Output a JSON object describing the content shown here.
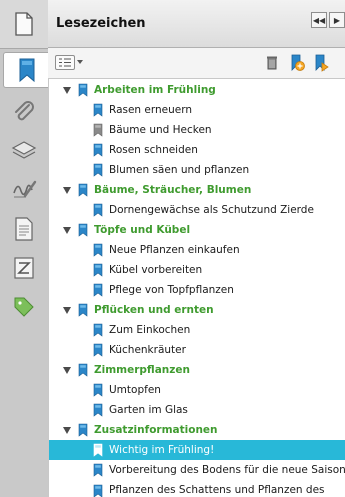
{
  "panel": {
    "title": "Lesezeichen",
    "header_buttons": [
      "◀◀",
      "▶"
    ]
  },
  "sidebar_icons": [
    "pages-icon",
    "bookmark-icon",
    "attachment-icon",
    "layers-icon",
    "signature-icon",
    "article-icon",
    "content-icon",
    "tag-icon"
  ],
  "colors": {
    "top_level_text": "#3f9b2f",
    "selected_row": "#28b8d8",
    "bookmark_blue": "#2b86c8",
    "bookmark_gray": "#8a8a8a"
  },
  "tree": [
    {
      "label": "Arbeiten im Frühling",
      "level": 0,
      "expanded": true,
      "icon": "blue"
    },
    {
      "label": "Rasen erneuern",
      "level": 1,
      "icon": "blue"
    },
    {
      "label": "Bäume und Hecken",
      "level": 1,
      "icon": "gray"
    },
    {
      "label": "Rosen schneiden",
      "level": 1,
      "icon": "blue"
    },
    {
      "label": "Blumen säen und pflanzen",
      "level": 1,
      "icon": "blue"
    },
    {
      "label": "Bäume, Sträucher, Blumen",
      "level": 0,
      "expanded": true,
      "icon": "blue"
    },
    {
      "label": "Dornengewächse als Schutzund Zierde",
      "level": 1,
      "icon": "blue"
    },
    {
      "label": "Töpfe und Kübel",
      "level": 0,
      "expanded": true,
      "icon": "blue"
    },
    {
      "label": "Neue Pflanzen einkaufen",
      "level": 1,
      "icon": "blue"
    },
    {
      "label": "Kübel vorbereiten",
      "level": 1,
      "icon": "blue"
    },
    {
      "label": "Pflege von Topfpflanzen",
      "level": 1,
      "icon": "blue"
    },
    {
      "label": "Pflücken und ernten",
      "level": 0,
      "expanded": true,
      "icon": "blue"
    },
    {
      "label": "Zum Einkochen",
      "level": 1,
      "icon": "blue"
    },
    {
      "label": "Küchenkräuter",
      "level": 1,
      "icon": "blue"
    },
    {
      "label": "Zimmerpflanzen",
      "level": 0,
      "expanded": true,
      "icon": "blue"
    },
    {
      "label": "Umtopfen",
      "level": 1,
      "icon": "blue"
    },
    {
      "label": "Garten im Glas",
      "level": 1,
      "icon": "blue"
    },
    {
      "label": "Zusatzinformationen",
      "level": 0,
      "expanded": true,
      "icon": "blue"
    },
    {
      "label": "Wichtig im Frühling!",
      "level": 1,
      "icon": "blue",
      "selected": true
    },
    {
      "label": "Vorbereitung des Bodens für die neue Saison",
      "level": 1,
      "icon": "blue"
    },
    {
      "label": "Pflanzen des Schattens und Pflanzen des Lichts",
      "level": 1,
      "icon": "blue"
    }
  ]
}
